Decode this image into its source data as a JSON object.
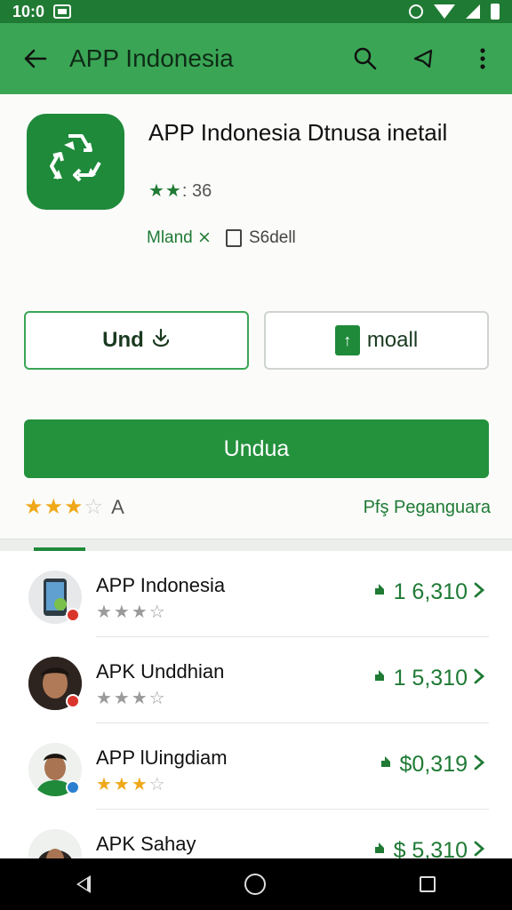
{
  "status_bar": {
    "time": "10:0"
  },
  "app_bar": {
    "title": "APP Indonesia"
  },
  "app": {
    "name": "APP Indonesia Dtnusa inetail",
    "rating_value": "36",
    "developer": "Mland ⨯",
    "size": "S6dell"
  },
  "buttons": {
    "secondary_left": "Und",
    "secondary_right": "moall",
    "primary": "Undua"
  },
  "rating_row": {
    "label": "A",
    "link": "Pfş Peganguara"
  },
  "list": [
    {
      "name": "APP Indonesia",
      "price": "1 6,310",
      "badge_color": "#d9352c"
    },
    {
      "name": "APK Unddhian",
      "price": "1 5,310",
      "badge_color": "#d9352c"
    },
    {
      "name": "APP lUingdiam",
      "price": "$0,319",
      "badge_color": "#2a7fd1"
    },
    {
      "name": "APK Sahay",
      "price": "$ 5,310",
      "badge_color": "#2a7fd1"
    }
  ],
  "colors": {
    "primary": "#24913d",
    "app_bar": "#3aa655",
    "star_gold": "#f0a81a"
  }
}
